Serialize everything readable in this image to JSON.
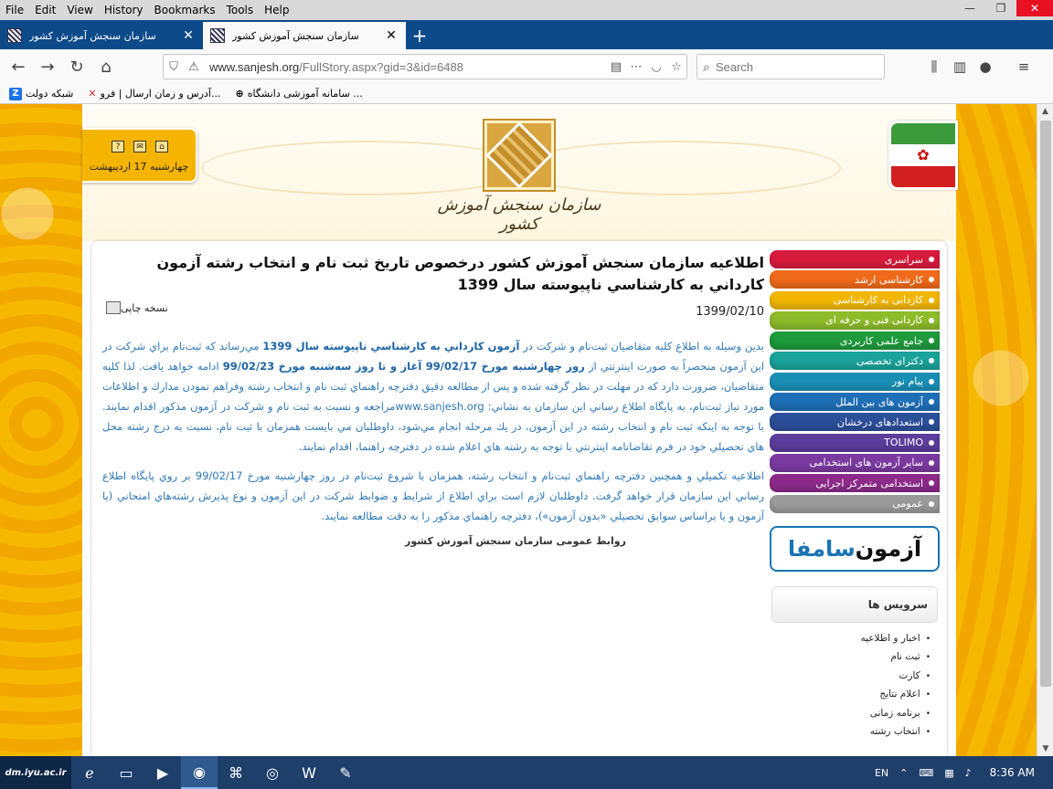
{
  "browser": {
    "menu": [
      "File",
      "Edit",
      "View",
      "History",
      "Bookmarks",
      "Tools",
      "Help"
    ],
    "tabs": [
      {
        "label": "سازمان سنجش آموزش کشور",
        "active": false
      },
      {
        "label": "سازمان سنجش آموزش کشور",
        "active": true
      }
    ],
    "url_host": "www.sanjesh.org",
    "url_path": "/FullStory.aspx?gid=3&id=6488",
    "search_placeholder": "Search",
    "bookmarks": [
      {
        "label": "شبکه دولت",
        "icon": "z-icon"
      },
      {
        "label": "آدرس و زمان ارسال | فرو...",
        "icon": "x-icon"
      },
      {
        "label": "سامانه آموزشی دانشگاه ...",
        "icon": "globe-icon"
      }
    ]
  },
  "site": {
    "title": "سازمان سنجش آموزش کشور",
    "date_label": "چهارشنبه 17 اردیبهشت",
    "article": {
      "title": "اطلاعيه سازمان سنجش آموزش كشور درخصوص تاريخ ثبت نام و انتخاب رشته آزمون كارداني به كارشناسي ناپيوسته سال 1399",
      "print_label": "نسخه چاپی",
      "date": "1399/02/10",
      "p1_a": "بدين وسيله به اطلاع كليه متقاضيان ثبت‌نام و شركت در",
      "p1_b1": "آزمون كارداني به كارشناسي ناپيوسته سال 1399",
      "p1_c": "مي‌رساند كه ثبت‌نام براي شركت در اين آزمون منحصراً به صورت اينترنتي از",
      "p1_b2": "روز چهارشنبه مورخ 99/02/17 آغاز و تا روز سه‌شنبه مورخ 99/02/23",
      "p1_d": "ادامه خواهد يافت. لذا كليه متقاضيان، ضرورت دارد كه در مهلت در نظر گرفته شده و پس از مطالعه دقيق دفترچه راهنماي ثبت نام و انتخاب رشته وفراهم نمودن مدارك و اطلاعات مورد نياز ثبت‌نام، به پايگاه اطلاع رساني اين سازمان به نشاني: www.sanjesh.orgمراجعه و نسبت به ثبت نام و شركت در آزمون مذكور اقدام نمايند. با توجه به اينكه ثبت نام و انتخاب رشته در اين آزمون، در يك مرحله انجام مي‌شود، داوطلبان مي بايست همزمان با ثبت نام، نسبت به درج رشته محل هاي تحصيلي خود در فرم تقاضانامه اينترنتي با توجه به رشته هاي اعلام شده در دفترچه راهنما، اقدام نمايند.",
      "p2": "اطلاعيه تكميلي و همچنين دفترچه راهنماي ثبت‌نام و انتخاب رشته، همزمان با شروع ثبت‌نام در روز چهارشنبه مورخ 99/02/17 بر روي پايگاه اطلاع رساني اين سازمان قرار خواهد گرفت. داوطلبان لازم است براي اطلاع از شرايط و ضوابط شركت در اين آزمون و نوع پذيرش رشته‌هاي امتحاني (با آزمون و يا براساس سوابق تحصيلي «بدون آزمون»)، دفترچه راهنماي مذكور را به دقت مطالعه نمايند.",
      "signature": "روابط عمومی سازمان سنجش آموزش کشور"
    },
    "side_menu": [
      {
        "label": "سراسری",
        "color": "#d81b3c"
      },
      {
        "label": "کارشناسی ارشد",
        "color": "#ef6a1a"
      },
      {
        "label": "کاردانی به کارشناسی",
        "color": "#f2b600"
      },
      {
        "label": "کاردانی فنی و حرفه ای",
        "color": "#8dbb2a"
      },
      {
        "label": "جامع علمی کاربردی",
        "color": "#1e9a3c"
      },
      {
        "label": "دکترای تخصصی",
        "color": "#1aa39a"
      },
      {
        "label": "پیام نور",
        "color": "#1a8fb5"
      },
      {
        "label": "آزمون های بین الملل",
        "color": "#1f6fb7"
      },
      {
        "label": "استعدادهای درخشان",
        "color": "#2c4f9a"
      },
      {
        "label": "TOLIMO",
        "color": "#5b3d9c"
      },
      {
        "label": "سایر آزمون های استخدامی",
        "color": "#7b3aa0"
      },
      {
        "label": "استخدامی متمرکز اجرایی",
        "color": "#8c2a8a"
      },
      {
        "label": "عمومی",
        "color": "#9a9a9a"
      }
    ],
    "samafa_a": "آزمون",
    "samafa_b": "سامفا",
    "services_title": "سرویس ها",
    "services": [
      "اخبار و اطلاعیه",
      "ثبت نام",
      "کارت",
      "اعلام نتایج",
      "برنامه زمانی",
      "انتخاب رشته"
    ]
  },
  "taskbar": {
    "start_label": "dm.iyu.ac.ir",
    "lang": "EN",
    "time": "8:36 AM"
  }
}
